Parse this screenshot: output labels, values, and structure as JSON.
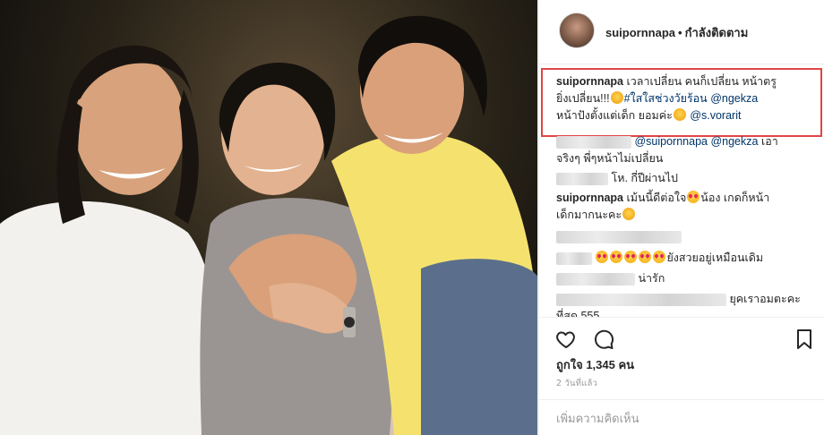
{
  "post": {
    "image_alt": "Photo of three friends smiling together",
    "header": {
      "username": "suipornnapa",
      "separator": "•",
      "follow_status": "กำลังติดตาม"
    },
    "caption": {
      "username": "suipornnapa",
      "text_line1": "เวลาเปลี่ยน คนก็เปลี่ยน หน้าตรู",
      "text_line2_a": "ยิ่งเปลี่ยน!!!",
      "hashtag": "#ใสใสช่วงวัยร้อน",
      "mention1": "@ngekza",
      "text_line3": "หน้าปังตั้งแต่เด็ก ยอมค่ะ",
      "mention2": "@s.vorarit"
    },
    "comments": [
      {
        "mention_a": "@suipornnapa",
        "mention_b": "@ngekza",
        "text_a": "เอา",
        "text_b": "จริงๆ พี่ๆหน้าไม่เปลี่ยน"
      },
      {
        "text": "โห. กี่ปีผ่านไป"
      },
      {
        "username": "suipornnapa",
        "text_a": "เม้นนี้ดีต่อใจ",
        "text_b": "น้อง เกดก็หน้า",
        "text_c": "เด็กมากนะคะ"
      },
      {
        "text": ""
      },
      {
        "text": "ยังสวยอยู่เหมือนเดิม"
      },
      {
        "text": "น่ารัก"
      },
      {
        "text_a": "ยุคเราอมตะคะ",
        "text_b": "ที่สุด 555"
      }
    ],
    "actions": {
      "like_icon": "heart-icon",
      "comment_icon": "comment-bubble-icon",
      "save_icon": "bookmark-icon"
    },
    "likes_text": "ถูกใจ 1,345 คน",
    "time_ago": "2 วันที่แล้ว",
    "add_comment_placeholder": "เพิ่มความคิดเห็น",
    "colors": {
      "highlight_border": "#e04545",
      "link": "#003569",
      "text": "#262626",
      "muted": "#999999"
    }
  }
}
